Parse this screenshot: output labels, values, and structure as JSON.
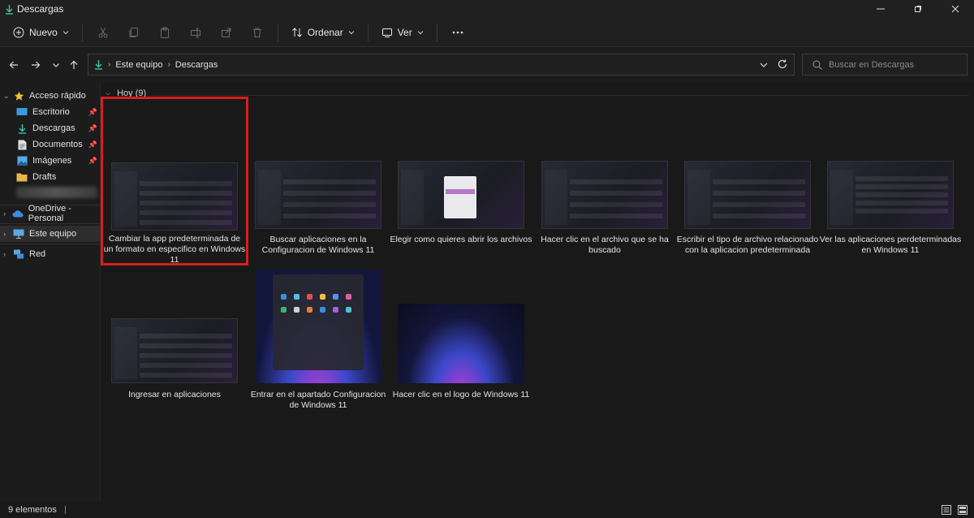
{
  "window": {
    "title": "Descargas",
    "controls": [
      "minimize-icon",
      "maximize-icon",
      "close-icon"
    ]
  },
  "commandbar": {
    "new_label": "Nuevo",
    "sort_label": "Ordenar",
    "view_label": "Ver",
    "icons": [
      "cut-icon",
      "copy-icon",
      "paste-icon",
      "rename-icon",
      "share-icon",
      "delete-icon",
      "more-icon"
    ]
  },
  "address": {
    "crumbs": [
      "Este equipo",
      "Descargas"
    ]
  },
  "search": {
    "placeholder": "Buscar en Descargas"
  },
  "sidebar": {
    "quick_access": "Acceso rápido",
    "items": [
      {
        "label": "Escritorio",
        "pinned": true
      },
      {
        "label": "Descargas",
        "pinned": true
      },
      {
        "label": "Documentos",
        "pinned": true
      },
      {
        "label": "Imágenes",
        "pinned": true
      },
      {
        "label": "Drafts",
        "pinned": false
      }
    ],
    "onedrive": "OneDrive - Personal",
    "this_pc": "Este equipo",
    "network": "Red"
  },
  "content": {
    "group_label": "Hoy (9)",
    "files": [
      {
        "caption": "Cambiar la app predeterminada de un formato en especifico en Windows 11",
        "selected": true
      },
      {
        "caption": "Buscar aplicaciones en la Configuracion de Windows 11"
      },
      {
        "caption": "Elegir como quieres abrir los archivos"
      },
      {
        "caption": "Hacer clic en el archivo que se ha buscado"
      },
      {
        "caption": "Escribir el tipo de archivo relacionado con la aplicacion predeterminada"
      },
      {
        "caption": "Ver las aplicaciones perdeterminadas en Windows 11"
      },
      {
        "caption": "Ingresar en aplicaciones"
      },
      {
        "caption": "Entrar en el apartado Configuracion de Windows 11"
      },
      {
        "caption": "Hacer clic en el logo de Windows 11"
      }
    ]
  },
  "status": {
    "count": "9 elementos"
  },
  "colors": {
    "accent": "#3a9bdc",
    "download": "#3cc2a8",
    "highlight": "#d81e1e",
    "folder": "#e8b54a"
  }
}
